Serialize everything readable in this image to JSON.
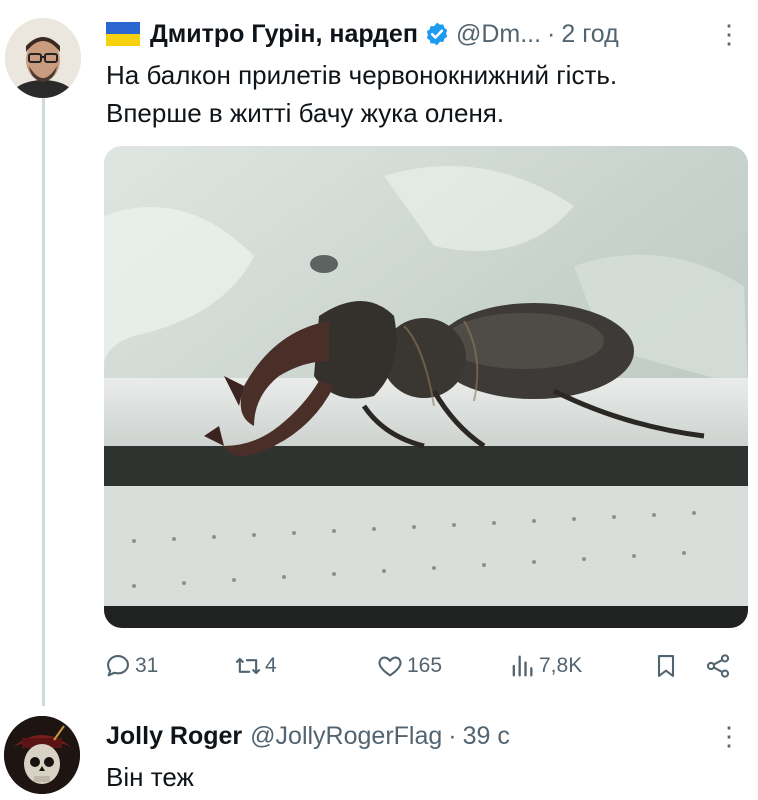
{
  "tweet": {
    "author_name": "Дмитро Гурін, нардеп",
    "handle": "@Dm...",
    "separator": "·",
    "time": "2 год",
    "text_line1": "На балкон прилетів червонокнижний гість.",
    "text_line2": "Вперше в житті бачу жука оленя.",
    "icons": [
      "flag-ukraine-icon",
      "verified-badge-icon",
      "more-options-icon"
    ],
    "colors": {
      "verified": "#1d9bf0",
      "secondary_text": "#536471",
      "flag_blue": "#2b66d1",
      "flag_yellow": "#f6d110"
    },
    "actions": {
      "replies": "31",
      "retweets": "4",
      "likes": "165",
      "views": "7,8K"
    }
  },
  "reply": {
    "author_name": "Jolly Roger",
    "handle": "@JollyRogerFlag",
    "separator": "·",
    "time": "39 с",
    "text": "Він теж"
  }
}
